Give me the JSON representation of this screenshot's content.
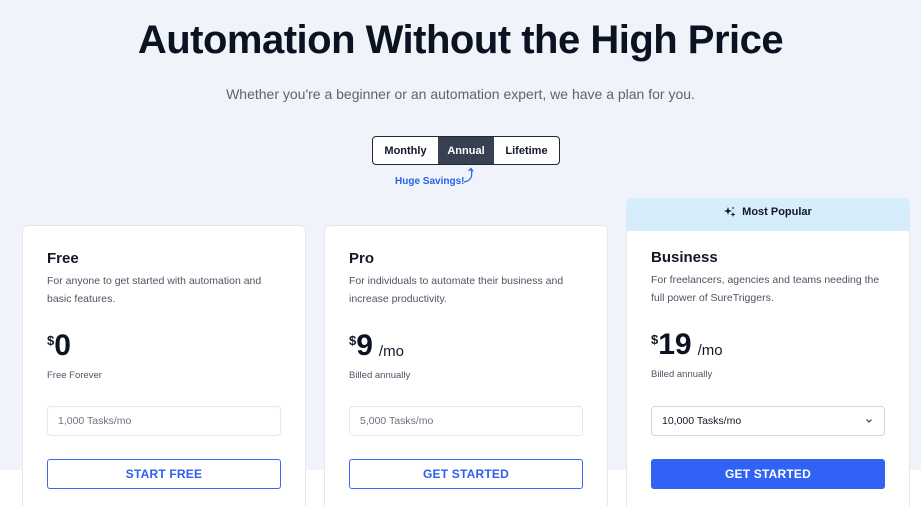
{
  "hero": {
    "title": "Automation Without the High Price",
    "subtitle": "Whether you're a beginner or an automation expert, we have a plan for you."
  },
  "billing_toggle": {
    "options": [
      "Monthly",
      "Annual",
      "Lifetime"
    ],
    "selected": "Annual",
    "savings_note": "Huge Savings!"
  },
  "badge": {
    "label": "Most Popular",
    "icon": "sparkle-icon"
  },
  "plans": [
    {
      "name": "Free",
      "description": "For anyone to get started with automation and basic features.",
      "currency": "$",
      "amount": "0",
      "period": "",
      "note": "Free Forever",
      "tasks": "1,000 Tasks/mo",
      "cta": "START FREE"
    },
    {
      "name": "Pro",
      "description": "For individuals to automate their business and increase productivity.",
      "currency": "$",
      "amount": "9",
      "period": "/mo",
      "note": "Billed annually",
      "tasks": "5,000 Tasks/mo",
      "cta": "GET STARTED"
    },
    {
      "name": "Business",
      "description": "For freelancers, agencies and teams needing the full power of SureTriggers.",
      "currency": "$",
      "amount": "19",
      "period": "/mo",
      "note": "Billed annually",
      "tasks": "10,000 Tasks/mo",
      "cta": "GET STARTED"
    }
  ],
  "colors": {
    "accent": "#2f62f5",
    "toggle_active": "#374151",
    "popular_bg": "#d6edfb",
    "page_bg": "#f0f3f9",
    "savings_text": "#2563eb"
  }
}
